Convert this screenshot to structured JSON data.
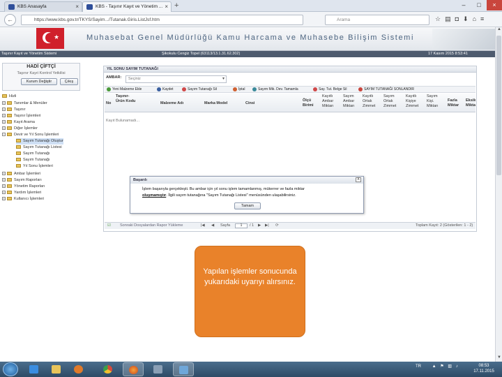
{
  "browser": {
    "tabs": [
      {
        "label": "KBS Anasayfa",
        "active": false
      },
      {
        "label": "KBS - Taşınır Kayıt ve Yönetim ...",
        "active": true
      }
    ],
    "url": "https://www.kbs.gov.tr/TKYS/Sayim.../Tutanak.Giris.ListJsf.htm",
    "search_placeholder": "Arama",
    "new_tab": "+",
    "back": "←"
  },
  "banner": {
    "title": "Muhasebat Genel Müdürlüğü Kamu Harcama ve Muhasebe Bilişim Sistemi"
  },
  "status_bar": {
    "left": "Taşınır Kayıt ve Yönetim Sistemi",
    "center": "Şikokulu Cengiz Topel (63113/13.1.31.62.302)",
    "right": "17 Kasım 2015 8:53:41"
  },
  "user": {
    "name": "HADİ ÇİFTÇİ",
    "subtitle": "Taşınır Kayıt Kontrol Yetkilisi",
    "change_institution": "Kurum Değiştir",
    "logout": "Çıkış"
  },
  "tree": {
    "root": "Hizli",
    "items": [
      {
        "label": "Tanımlar & Menüler",
        "level": 0,
        "selected": false
      },
      {
        "label": "Taşınır",
        "level": 0,
        "selected": false
      },
      {
        "label": "Taşınır İşlemleri",
        "level": 0,
        "selected": false
      },
      {
        "label": "Kayıt Arama",
        "level": 0,
        "selected": false
      },
      {
        "label": "Diğer İşlemler",
        "level": 0,
        "selected": false
      },
      {
        "label": "Devir ve Yıl Sonu İşlemleri",
        "level": 0,
        "selected": false
      },
      {
        "label": "Sayım Tutanağı Oluştur",
        "level": 1,
        "selected": true
      },
      {
        "label": "Sayım Tutanağı Listesi",
        "level": 1,
        "selected": false
      },
      {
        "label": "Sayım Tutanağı",
        "level": 1,
        "selected": false
      },
      {
        "label": "Sayım Tutanağı",
        "level": 1,
        "selected": false
      },
      {
        "label": "Yıl Sonu İşlemleri",
        "level": 1,
        "selected": false
      },
      {
        "label": "Ambar İşlemleri",
        "level": 0,
        "selected": false
      },
      {
        "label": "Sayım Raporları",
        "level": 0,
        "selected": false
      },
      {
        "label": "Yönetim Raporları",
        "level": 0,
        "selected": false
      },
      {
        "label": "Yardım İşlemleri",
        "level": 0,
        "selected": false
      },
      {
        "label": "Kullanıcı İşlemleri",
        "level": 0,
        "selected": false
      }
    ]
  },
  "panel": {
    "title": "YIL SONU SAYIM TUTANAĞI",
    "ambar_label": "AMBAR:",
    "ambar_placeholder": "Seçiniz",
    "toolbar": [
      "Yeni Malzeme Ekle",
      "Kaydet",
      "Sayım Tutanağı Sil",
      "İptal",
      "Sayım Mik. Dev. Tamamla",
      "Say. Tut. Belge Sil",
      "SAYIM TUTANAĞI SONLANDIR"
    ],
    "columns": [
      {
        "label": "No",
        "bold": true
      },
      {
        "label": "Taşınır-Ürün Kodu",
        "bold": true
      },
      {
        "label": "Malzeme Adı",
        "bold": true
      },
      {
        "label": "Marka Model",
        "bold": true
      },
      {
        "label": "Cinsi",
        "bold": true
      },
      {
        "label": "Ölçü Birimi",
        "bold": true
      },
      {
        "label": "Kayıtlı Ambar Miktarı",
        "bold": false
      },
      {
        "label": "Sayım Ambar Miktarı",
        "bold": false
      },
      {
        "label": "Kayıtlı Ortak Zimmet",
        "bold": false
      },
      {
        "label": "Sayım Ortak Zimmet",
        "bold": false
      },
      {
        "label": "Kayıtlı Kişiye Zimmet",
        "bold": false
      },
      {
        "label": "Sayım Kişi. Miktarı",
        "bold": false
      },
      {
        "label": "Fazla Miktar",
        "bold": true
      },
      {
        "label": "Eksik Miktar",
        "bold": true
      }
    ],
    "empty_text": "Kayıt Bulunamadı...",
    "pager": {
      "bottom_link": "Sonraki Dosyalardan Rapor Yükleme",
      "page_label": "Sayfa",
      "page_value": "1",
      "of_label": "/ 1",
      "total": "Toplam Kayıt: 2 (Gösterilen: 1 - 2)"
    }
  },
  "dialog": {
    "title": "Başarılı",
    "message_line1": "İşlem başarıyla gerçekleşti. Bu ambar için yıl sonu işlem tamamlanmış, mükerrer ve fazla miktar",
    "message_link": "oluşmamıştır",
    "message_line2": ". İlgili sayım tutanağına \"Sayım Tutanağı Listesi\" menüsünden ulaşabilirsiniz.",
    "ok_button": "Tamam",
    "close": "X"
  },
  "callout": {
    "text": "Yapılan işlemler sonucunda yukarıdaki uyarıyı alırsınız."
  },
  "taskbar": {
    "language": "TR",
    "time": "08:53",
    "date": "17.11.2015"
  },
  "colors": {
    "callout": "#e9822a",
    "status_bar": "#4e5b6e",
    "flag": "#d0202b"
  }
}
